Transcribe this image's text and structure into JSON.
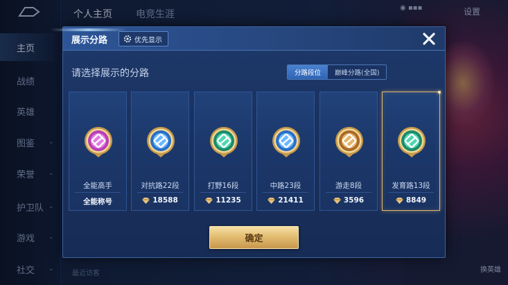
{
  "background": {
    "sidebar": [
      {
        "label": "主页",
        "active": true
      },
      {
        "label": "战绩",
        "active": false
      },
      {
        "label": "英雄",
        "active": false
      },
      {
        "label": "图鉴",
        "active": false,
        "chevron": true
      },
      {
        "label": "荣誉",
        "active": false,
        "chevron": true
      },
      {
        "label": "护卫队",
        "active": false,
        "chevron": true
      },
      {
        "label": "游戏",
        "active": false,
        "chevron": true
      },
      {
        "label": "社交",
        "active": false,
        "chevron": true
      }
    ],
    "top_tabs": [
      "个人主页",
      "电竞生涯"
    ],
    "settings_label": "设置",
    "recent_label": "最近访客",
    "bottom_right_label": "换英雄"
  },
  "modal": {
    "title": "展示分路",
    "priority_button": "优先显示",
    "subtitle": "请选择展示的分路",
    "segments": [
      {
        "label": "分路段位",
        "active": true
      },
      {
        "label": "巅峰分路(全国)",
        "active": false
      }
    ],
    "cards": [
      {
        "name": "全能高手",
        "score": "全能称号",
        "icon": "all-round-badge-icon",
        "selected": false,
        "show_diamond": false,
        "ring": "#b93fb5",
        "inner": "#e27de0"
      },
      {
        "name": "对抗路22段",
        "score": "18588",
        "icon": "clash-lane-badge-icon",
        "selected": false,
        "show_diamond": true,
        "ring": "#2c6ec7",
        "inner": "#6bb8ff"
      },
      {
        "name": "打野16段",
        "score": "11235",
        "icon": "jungle-badge-icon",
        "selected": false,
        "show_diamond": true,
        "ring": "#1f8a6b",
        "inner": "#4fd6b0"
      },
      {
        "name": "中路23段",
        "score": "21411",
        "icon": "mid-lane-badge-icon",
        "selected": false,
        "show_diamond": true,
        "ring": "#2c6ec7",
        "inner": "#6bb8ff"
      },
      {
        "name": "游走8段",
        "score": "3596",
        "icon": "roam-badge-icon",
        "selected": false,
        "show_diamond": true,
        "ring": "#a86a2a",
        "inner": "#e7b46a"
      },
      {
        "name": "发育路13段",
        "score": "8849",
        "icon": "farm-lane-badge-icon",
        "selected": true,
        "show_diamond": true,
        "ring": "#1f8a6b",
        "inner": "#4fd6b0"
      }
    ],
    "confirm_label": "确定"
  },
  "colors": {
    "gold": "#e7b96d",
    "panel": "#1a3260",
    "accent": "#3f7acb"
  }
}
